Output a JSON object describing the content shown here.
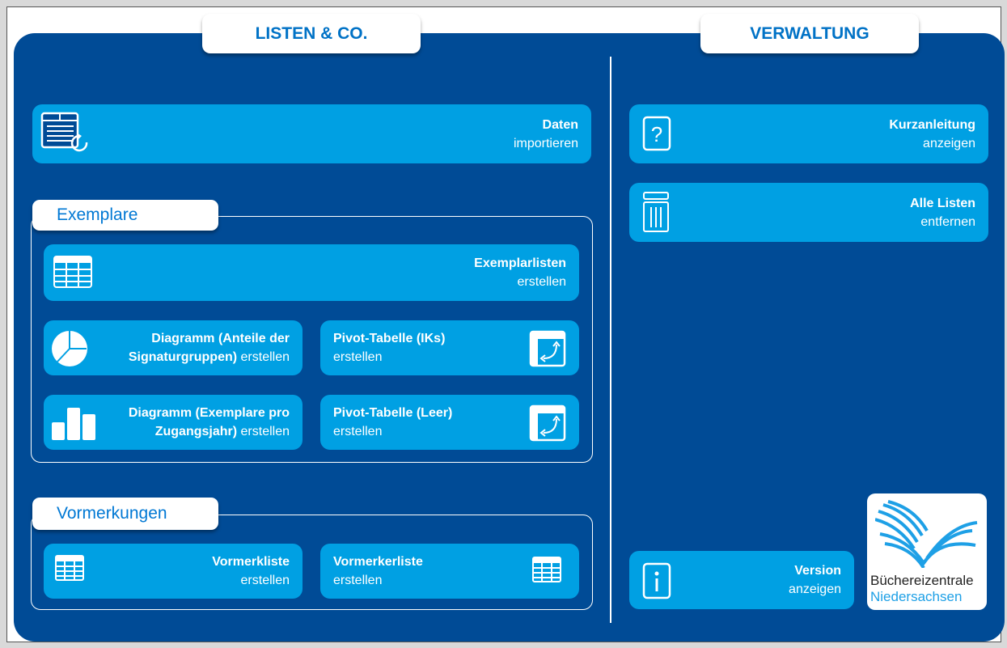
{
  "sections": {
    "lists_title": "LISTEN & CO.",
    "admin_title": "VERWALTUNG"
  },
  "buttons": {
    "data_import": {
      "title": "Daten",
      "sub": "importieren"
    },
    "exemplar_lists": {
      "title": "Exemplarlisten",
      "sub": "erstellen"
    },
    "chart_signature": {
      "title1": "Diagramm (Anteile der",
      "title2": "Signaturgruppen)",
      "sub": " erstellen"
    },
    "pivot_iks": {
      "title": "Pivot-Tabelle (IKs)",
      "sub": "erstellen"
    },
    "chart_accession": {
      "title1": "Diagramm (Exemplare pro",
      "title2": "Zugangsjahr)",
      "sub": " erstellen"
    },
    "pivot_empty": {
      "title": "Pivot-Tabelle (Leer)",
      "sub": "erstellen"
    },
    "reservation_list": {
      "title": "Vormerkliste",
      "sub": "erstellen"
    },
    "reserver_list": {
      "title": "Vormerkerliste",
      "sub": "erstellen"
    },
    "quick_guide": {
      "title": "Kurzanleitung",
      "sub": "anzeigen"
    },
    "remove_all": {
      "title": "Alle Listen",
      "sub": "entfernen"
    },
    "version": {
      "title": "Version",
      "sub": "anzeigen"
    }
  },
  "groups": {
    "exemplare": "Exemplare",
    "vormerkungen": "Vormerkungen"
  },
  "logo": {
    "line1": "Büchereizentrale",
    "line2": "Niedersachsen"
  },
  "colors": {
    "panel": "#004b96",
    "button": "#00a0e3",
    "title_text": "#0072c6"
  }
}
